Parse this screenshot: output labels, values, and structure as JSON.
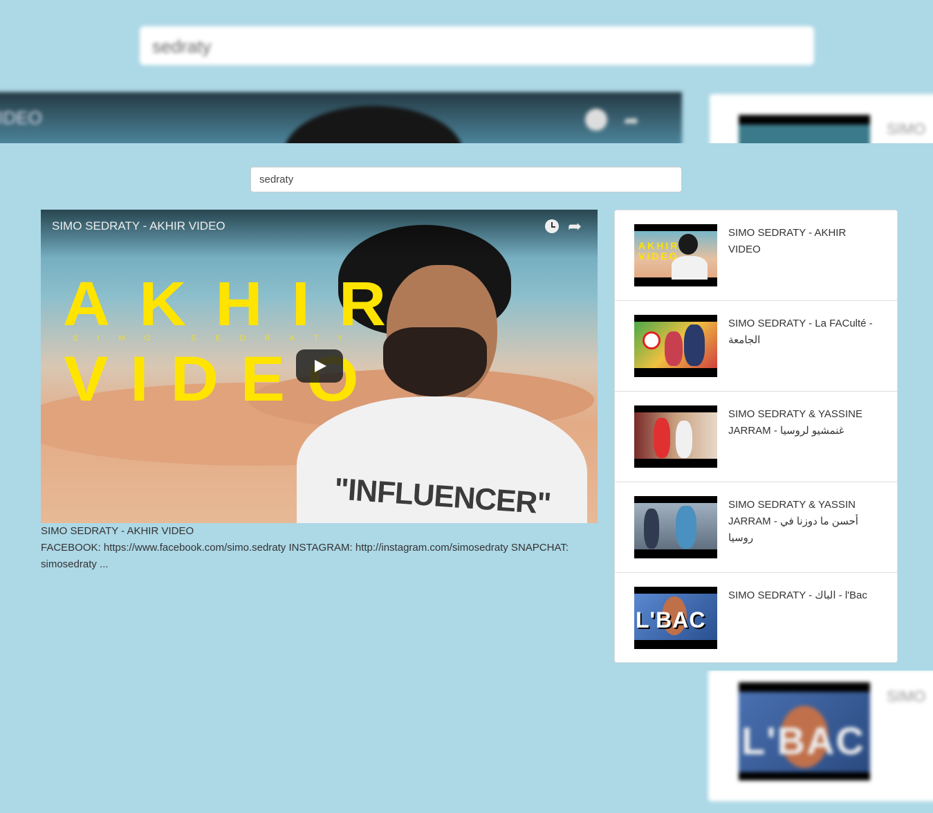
{
  "search": {
    "value": "sedraty"
  },
  "player": {
    "title": "SIMO SEDRATY - AKHIR VIDEO",
    "thumbnail_text_line1": "AKHIR",
    "thumbnail_text_line2": "VIDEO",
    "thumbnail_subtext": "SIMO SEDRATY",
    "thumbnail_shirt_text": "\"INFLUENCER\"",
    "icons": [
      "clock-icon",
      "share-icon",
      "play-icon"
    ]
  },
  "video_info": {
    "title": "SIMO SEDRATY - AKHIR VIDEO",
    "description": "FACEBOOK: https://www.facebook.com/simo.sedraty INSTAGRAM: http://instagram.com/simosedraty SNAPCHAT: simosedraty ..."
  },
  "results": [
    {
      "title": "SIMO SEDRATY - AKHIR VIDEO",
      "thumb_text": "AKHIR VIDEO"
    },
    {
      "title": "SIMO SEDRATY - La FACulté - الجامعة"
    },
    {
      "title": "SIMO SEDRATY & YASSINE JARRAM - غنمشيو لروسيا"
    },
    {
      "title": "SIMO SEDRATY & YASSIN JARRAM - أحسن ما دوزنا في روسيا"
    },
    {
      "title": "SIMO SEDRATY - الباك - l'Bac",
      "thumb_text": "L'BAC"
    }
  ]
}
